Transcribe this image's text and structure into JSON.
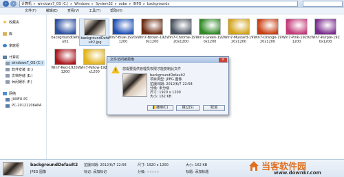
{
  "address": {
    "crumbs": [
      "计算机",
      "windows7_OS (C:)",
      "Windows",
      "System32",
      "oobe",
      "INFO",
      "backgrounds"
    ]
  },
  "search": {
    "placeholder": ""
  },
  "menu": [
    "文件(F)",
    "编辑(E)",
    "查看(V)",
    "工具(T)",
    "帮助(H)"
  ],
  "sidebar": {
    "favorites": "收藏夹",
    "library": "库",
    "homegroup": "家庭组",
    "computer": "计算机",
    "drives": [
      {
        "label": "windows7_OS (C:)",
        "selected": true
      },
      {
        "label": "软件安装 (D:)",
        "selected": false
      },
      {
        "label": "文档存储 (E:)",
        "selected": false
      },
      {
        "label": "休闲娱乐 (F:)",
        "selected": false
      }
    ],
    "network": "网络",
    "pcs": [
      "JUNFU-PC",
      "PC-20121206APA"
    ]
  },
  "files": [
    {
      "name": "backgroundDefault1",
      "color": "#2a4fa0",
      "selected": false
    },
    {
      "name": "backgroundDefault2.jpg",
      "color": "#3a3330",
      "selected": true
    },
    {
      "name": "Win7-Blue-1920x1200",
      "color": "#1d4fb3",
      "selected": false
    },
    {
      "name": "Win7-Brown-1920x1200",
      "color": "#6b2a10",
      "selected": false
    },
    {
      "name": "Win7-Chrome-1920x1200",
      "color": "#4a5260",
      "selected": false
    },
    {
      "name": "Win7-Green-1920x1200",
      "color": "#2f8a24",
      "selected": false
    },
    {
      "name": "Win7-Mustard-1920x1200",
      "color": "#d2a21a",
      "selected": false
    },
    {
      "name": "Win7-Orange-1920x1200",
      "color": "#c93e12",
      "selected": false
    },
    {
      "name": "Win7-Pink-1920x1200",
      "color": "#c23a78",
      "selected": false
    },
    {
      "name": "Win7-Purple-1920x1200",
      "color": "#7a2c8e",
      "selected": false
    },
    {
      "name": "Win7-Red-1920x1200",
      "color": "#a8131a",
      "selected": false
    },
    {
      "name": "Win7-Yellow-1920x1200",
      "color": "#e2b31e",
      "selected": false
    }
  ],
  "dialog": {
    "title": "文件访问被拒绝",
    "close": "×",
    "message": "您需要提供管理员权限才能复制此文件",
    "file_name": "backgroundDefault2",
    "type_line": "项目类型: JPEG 图像",
    "date_line": "拍摄日期: 2012/6/7 22:58",
    "rating_line": "分级: 未分级",
    "size_line": "尺寸: 1920 x 1200",
    "filesize_line": "大小: 162 KB",
    "continue_label": "继续(C)",
    "skip_label": "跳过(S)",
    "cancel_label": "取消"
  },
  "status": {
    "name": "backgroundDefault2",
    "type": "JPEG 图像",
    "date_label": "拍摄日期:",
    "date_value": "2012/6/7 22:58",
    "tag_label": "标记:",
    "tag_value": "添加标记",
    "size_label": "尺寸:",
    "size_value": "1920 x 1200",
    "rating_label": "分级:",
    "filesize_label": "大小:",
    "filesize_value": "162 KB",
    "title_label": "标题:",
    "title_value": "添加标题"
  },
  "watermark": {
    "brand": "当客软件园",
    "url": "www.downkr.com"
  },
  "colors": {
    "accent": "#3d6fb7",
    "dialog_close": "#c9443a",
    "warning": "#f2c021",
    "watermark": "#e07020"
  }
}
